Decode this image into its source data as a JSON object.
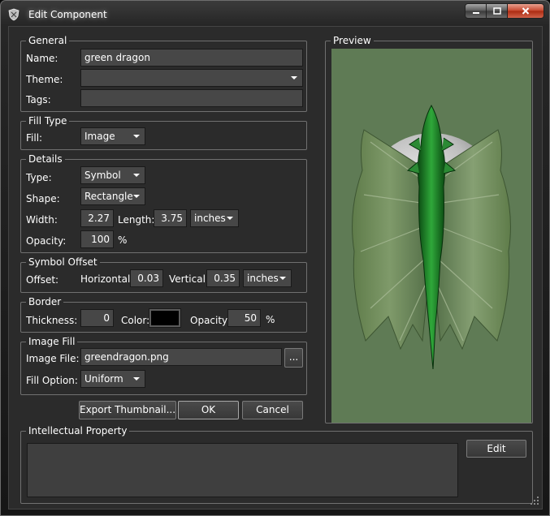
{
  "window": {
    "title": "Edit Component"
  },
  "general": {
    "legend": "General",
    "name_label": "Name:",
    "name_value": "green dragon",
    "theme_label": "Theme:",
    "theme_value": "",
    "tags_label": "Tags:",
    "tags_value": ""
  },
  "fill_type": {
    "legend": "Fill Type",
    "fill_label": "Fill:",
    "fill_value": "Image"
  },
  "details": {
    "legend": "Details",
    "type_label": "Type:",
    "type_value": "Symbol",
    "shape_label": "Shape:",
    "shape_value": "Rectangle",
    "width_label": "Width:",
    "width_value": "2.27",
    "length_label": "Length:",
    "length_value": "3.75",
    "units_value": "inches",
    "opacity_label": "Opacity:",
    "opacity_value": "100",
    "percent": "%"
  },
  "symbol_offset": {
    "legend": "Symbol Offset",
    "offset_label": "Offset:",
    "horizontal_label": "Horizontal:",
    "horizontal_value": "0.03",
    "vertical_label": "Vertical:",
    "vertical_value": "0.35",
    "units_value": "inches"
  },
  "border": {
    "legend": "Border",
    "thickness_label": "Thickness:",
    "thickness_value": "0",
    "color_label": "Color:",
    "color_value": "#000000",
    "opacity_label": "Opacity:",
    "opacity_value": "50",
    "percent": "%"
  },
  "image_fill": {
    "legend": "Image Fill",
    "file_label": "Image File:",
    "file_value": "greendragon.png",
    "browse_label": "...",
    "fill_option_label": "Fill Option:",
    "fill_option_value": "Uniform"
  },
  "actions": {
    "export_label": "Export Thumbnail...",
    "ok_label": "OK",
    "cancel_label": "Cancel"
  },
  "preview": {
    "legend": "Preview",
    "background_color": "#5f7b55"
  },
  "intellectual_property": {
    "legend": "Intellectual Property",
    "value": "",
    "edit_label": "Edit"
  }
}
